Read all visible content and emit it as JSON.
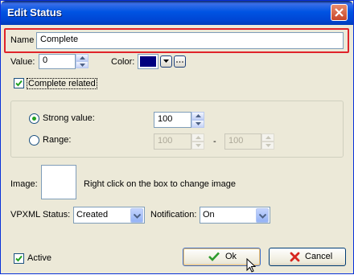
{
  "window": {
    "title": "Edit Status"
  },
  "name_field": {
    "label": "Name",
    "value": "Complete"
  },
  "value_field": {
    "label": "Value:",
    "value": "0"
  },
  "color_field": {
    "label": "Color:",
    "swatch": "#00007f"
  },
  "complete_related": {
    "label": "Complete related",
    "checked": true
  },
  "strong_value": {
    "label": "Strong value:",
    "value": "100",
    "selected": true
  },
  "range": {
    "label": "Range:",
    "from": "100",
    "separator": "-",
    "to": "100",
    "selected": false
  },
  "image": {
    "label": "Image:",
    "hint": "Right click on the box to  change image"
  },
  "vpxml": {
    "label": "VPXML Status:",
    "value": "Created"
  },
  "notification": {
    "label": "Notification:",
    "value": "On"
  },
  "active": {
    "label": "Active",
    "checked": true
  },
  "buttons": {
    "ok": "Ok",
    "cancel": "Cancel"
  },
  "colors": {
    "accent_highlight": "#e0242a",
    "title_bar": "#0054e3",
    "dialog_bg": "#ece9d8"
  }
}
